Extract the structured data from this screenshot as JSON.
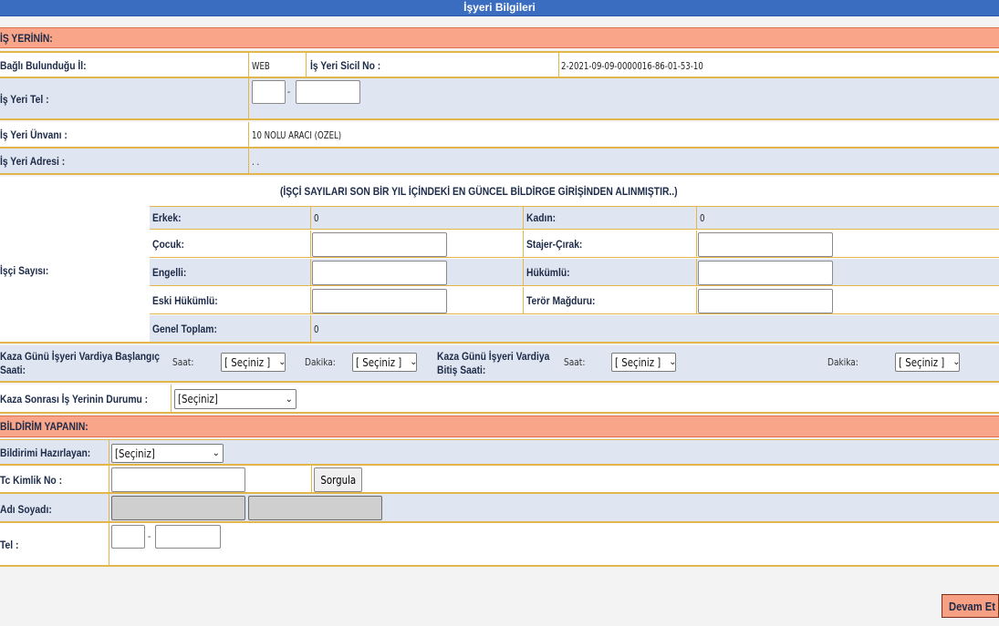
{
  "header": {
    "title": "İşyeri Bilgileri"
  },
  "isyeri_section": {
    "title": "İŞ YERİNİN:"
  },
  "bagli_il": {
    "label": "Bağlı Bulunduğu İl:",
    "value": "WEB"
  },
  "sicil_no": {
    "label": "İş Yeri Sicil No :",
    "value": "2-2021-09-09-0000016-86-01-53-10"
  },
  "tel": {
    "label": "İş Yeri Tel :",
    "separator": "-",
    "area": "",
    "number": ""
  },
  "unvan": {
    "label": "İş Yeri Ünvanı :",
    "value": "10 NOLU ARACI (OZEL)"
  },
  "adres": {
    "label": "İş Yeri Adresi :",
    "value": ". ."
  },
  "isci": {
    "label": "İşçi Sayısı:",
    "note": "(İŞÇİ SAYILARI SON BİR YIL İÇİNDEKİ EN GÜNCEL BİLDİRGE GİRİŞİNDEN ALINMIŞTIR..)",
    "erkek_label": "Erkek:",
    "erkek_value": "0",
    "kadin_label": "Kadın:",
    "kadin_value": "0",
    "cocuk_label": "Çocuk:",
    "stajer_label": "Stajer-Çırak:",
    "engelli_label": "Engelli:",
    "hukumlu_label": "Hükümlü:",
    "eski_hukumlu_label": "Eski Hükümlü:",
    "teror_label": "Terör Mağduru:",
    "genel_toplam_label": "Genel Toplam:",
    "genel_toplam_value": "0"
  },
  "vardiya": {
    "start_label_1": "Kaza Günü İşyeri Vardiya Başlangıç",
    "start_label_2": "Saati:",
    "end_label_1": "Kaza Günü İşyeri Vardiya",
    "end_label_2": "Bitiş Saati:",
    "saat_label": "Saat:",
    "dakika_label": "Dakika:",
    "select_value": "[ Seçiniz ]"
  },
  "durum": {
    "label": "Kaza Sonrası İş Yerinin Durumu :",
    "value": "[Seçiniz]"
  },
  "bildirim_section": {
    "title": "BİLDİRİM YAPANIN:"
  },
  "hazirlayan": {
    "label": "Bildirimi Hazırlayan:",
    "value": "[Seçiniz]"
  },
  "tc": {
    "label": "Tc Kimlik No :",
    "button": "Sorgula"
  },
  "ad_soyad": {
    "label": "Adı Soyadı:"
  },
  "bildiren_tel": {
    "label": "Tel :",
    "separator": "-"
  },
  "actions": {
    "devam": "Devam Et"
  }
}
